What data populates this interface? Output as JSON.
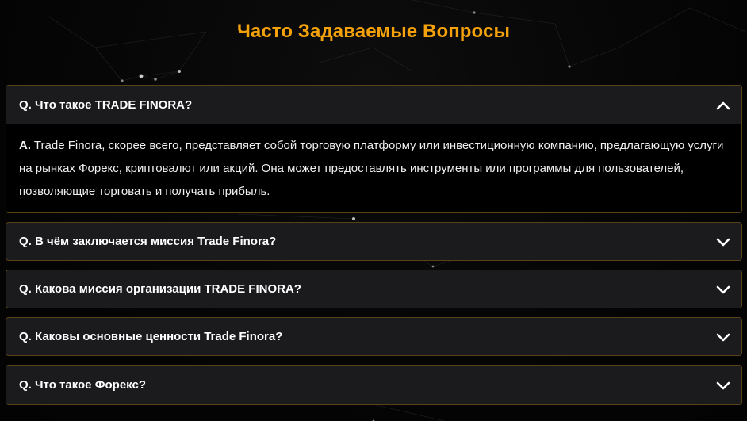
{
  "page": {
    "title": "Часто Задаваемые Вопросы",
    "accent_color": "#f5a20a",
    "border_color": "#5a4218"
  },
  "faq": [
    {
      "question": "Q. Что такое TRADE FINORA?",
      "state": "expanded",
      "icon": "chevron-up-icon",
      "answer_label": "A.",
      "answer": "Trade Finora, скорее всего, представляет собой торговую платформу или инвестиционную компанию, предлагающую услуги на рынках Форекс, криптовалют или акций. Она может предоставлять инструменты или программы для пользователей, позволяющие торговать и получать прибыль."
    },
    {
      "question": "Q.  В чём заключается миссия Trade Finora?",
      "state": "collapsed",
      "icon": "chevron-down-icon"
    },
    {
      "question": "Q. Какова миссия организации TRADE FINORA?",
      "state": "collapsed",
      "icon": "chevron-down-icon"
    },
    {
      "question": "Q.  Каковы основные ценности Trade Finora?",
      "state": "collapsed",
      "icon": "chevron-down-icon"
    },
    {
      "question": "Q.  Что такое Форекс?",
      "state": "collapsed",
      "icon": "chevron-down-icon"
    }
  ]
}
